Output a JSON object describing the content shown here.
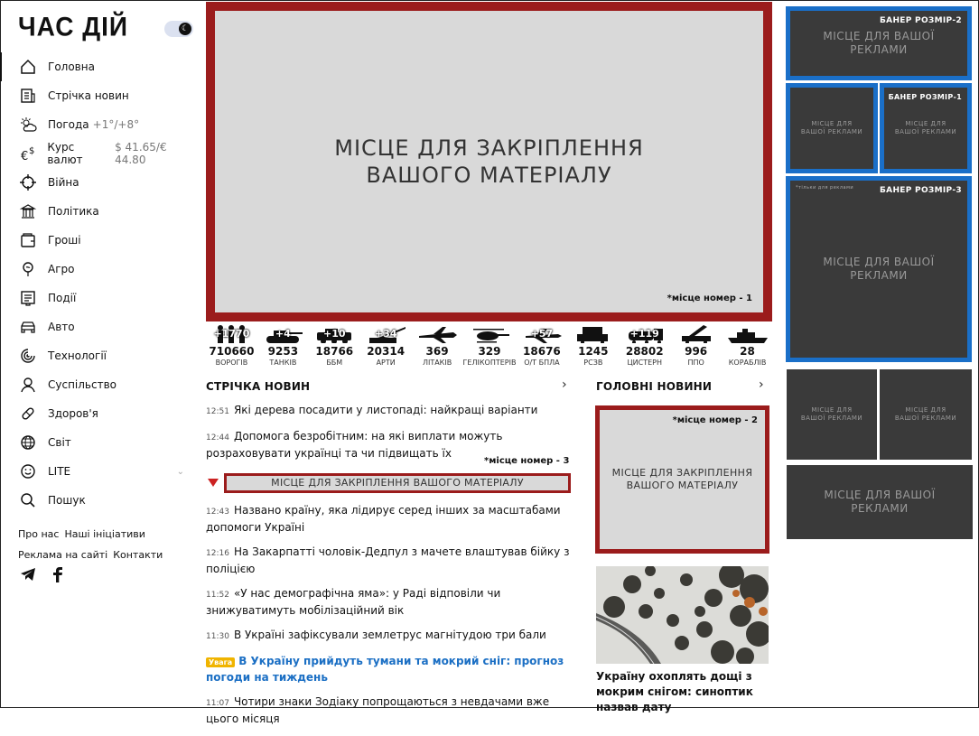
{
  "site": {
    "logo": "ЧАС ДІЙ",
    "toggle_icon": "moon-icon"
  },
  "nav": [
    {
      "label": "Головна",
      "icon": "home-icon",
      "active": true
    },
    {
      "label": "Стрічка новин",
      "icon": "feed-icon"
    },
    {
      "label": "Погода",
      "icon": "weather-icon",
      "extra": "+1°/+8°"
    },
    {
      "label": "Курс валют",
      "icon": "currency-icon",
      "extra": "$ 41.65/€ 44.80"
    },
    {
      "label": "Війна",
      "icon": "crosshair-icon"
    },
    {
      "label": "Політика",
      "icon": "politics-icon"
    },
    {
      "label": "Гроші",
      "icon": "wallet-icon"
    },
    {
      "label": "Агро",
      "icon": "agro-icon"
    },
    {
      "label": "Події",
      "icon": "events-icon"
    },
    {
      "label": "Авто",
      "icon": "car-icon"
    },
    {
      "label": "Технології",
      "icon": "tech-icon"
    },
    {
      "label": "Суспільство",
      "icon": "user-icon"
    },
    {
      "label": "Здоров'я",
      "icon": "pill-icon"
    },
    {
      "label": "Світ",
      "icon": "globe-icon"
    },
    {
      "label": "LITE",
      "icon": "smile-icon",
      "has_chevron": true
    },
    {
      "label": "Пошук",
      "icon": "search-icon"
    }
  ],
  "footer": {
    "row1": [
      "Про нас",
      "Наші ініціативи"
    ],
    "row2": [
      "Реклама на сайті",
      "Контакти"
    ]
  },
  "pin1": {
    "text": "МІСЦЕ ДЛЯ ЗАКРІПЛЕННЯ ВАШОГО МАТЕРІАЛУ",
    "note": "*місце номер - 1"
  },
  "stats": [
    {
      "delta": "+1770",
      "value": "710660",
      "label": "ВОРОГІВ"
    },
    {
      "delta": "+4",
      "value": "9253",
      "label": "ТАНКІВ"
    },
    {
      "delta": "+10",
      "value": "18766",
      "label": "ББМ"
    },
    {
      "delta": "+34",
      "value": "20314",
      "label": "АРТИ"
    },
    {
      "delta": "",
      "value": "369",
      "label": "ЛІТАКІВ"
    },
    {
      "delta": "",
      "value": "329",
      "label": "ГЕЛІКОПТЕРІВ"
    },
    {
      "delta": "+57",
      "value": "18676",
      "label": "О/Т БПЛА"
    },
    {
      "delta": "",
      "value": "1245",
      "label": "РСЗВ"
    },
    {
      "delta": "+119",
      "value": "28802",
      "label": "ЦИСТЕРН"
    },
    {
      "delta": "",
      "value": "996",
      "label": "ППО"
    },
    {
      "delta": "",
      "value": "28",
      "label": "КОРАБЛІВ"
    }
  ],
  "feed": {
    "title": "СТРІЧКА НОВИН",
    "items_before": [
      {
        "time": "12:51",
        "text": "Які дерева посадити у листопаді: найкращі варіанти"
      },
      {
        "time": "12:44",
        "text": "Допомога безробітним: на які виплати можуть розраховувати українці та чи підвищать їх"
      }
    ],
    "pin3": {
      "text": "МІСЦЕ ДЛЯ ЗАКРІПЛЕННЯ ВАШОГО МАТЕРІАЛУ",
      "note": "*місце номер - 3"
    },
    "items_after": [
      {
        "time": "12:43",
        "text": "Названо країну, яка лідирує серед інших за масштабами допомоги Україні"
      },
      {
        "time": "12:16",
        "text": "На Закарпатті чоловік-Дедпул з мачете влаштував бійку з поліцією"
      },
      {
        "time": "11:52",
        "text": "«У нас демографічна яма»: у Раді відповіли чи знижуватимуть мобілізаційний вік"
      },
      {
        "time": "11:30",
        "text": "В Україні зафіксували землетрус магнітудою три бали"
      }
    ],
    "alert": {
      "badge": "Увага",
      "text": "В Україну прийдуть тумани та мокрий сніг: прогноз погоди на тиждень"
    },
    "last": {
      "time": "11:07",
      "text": "Чотири знаки Зодіаку попрощаються з невдачами вже цього місяця"
    }
  },
  "top_news": {
    "title": "ГОЛОВНІ НОВИНИ",
    "pin2": {
      "text": "МІСЦЕ ДЛЯ ЗАКРІПЛЕННЯ ВАШОГО МАТЕРІАЛУ",
      "note": "*місце номер - 2"
    },
    "caption": "Україну охоплять дощі з мокрим снігом: синоптик назвав дату"
  },
  "banners": {
    "ad_text": "МІСЦЕ ДЛЯ ВАШОЇ РЕКЛАМИ",
    "size2": "БАНЕР РОЗМІР-2",
    "size1": "БАНЕР РОЗМІР-1",
    "size3": "БАНЕР РОЗМІР-3",
    "tiny": "*тільки для реклами"
  },
  "colors": {
    "pin_border": "#9b1c1c",
    "banner_border": "#1a6fc8",
    "banner_bg": "#3a3a3a",
    "alert": "#1b6fc4",
    "badge": "#f0b400"
  }
}
